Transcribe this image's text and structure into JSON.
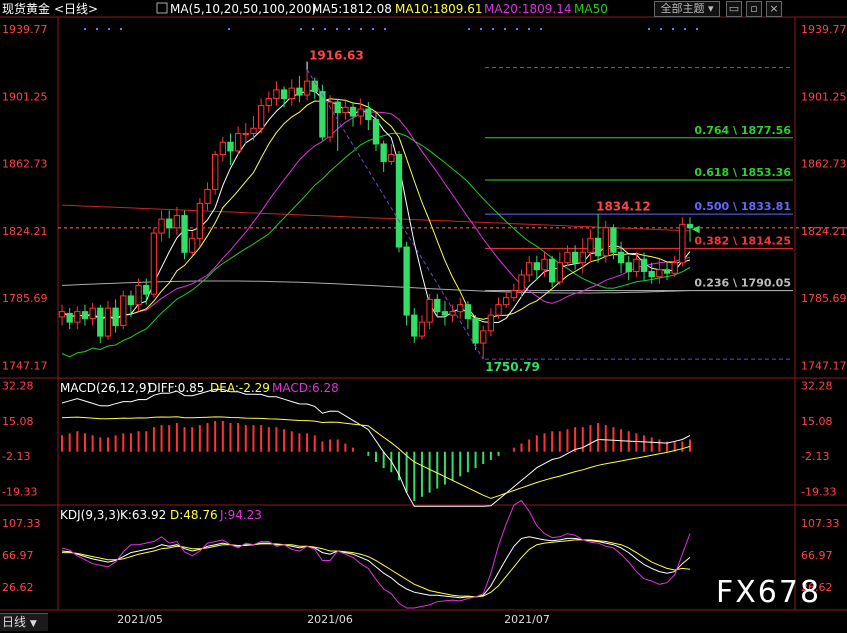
{
  "header": {
    "instrument": "现货黄金",
    "period": "日线",
    "ma_label": "MA(5,10,20,50,100,200)",
    "ma5": "MA5:1812.08",
    "ma10": "MA10:1809.61",
    "ma20": "MA20:1809.14",
    "ma50": "MA50",
    "theme_button": "全部主题",
    "colors": {
      "ma5": "#ffffff",
      "ma10": "#ffff44",
      "ma20": "#dd33dd",
      "ma50": "#22cc22",
      "ma100": "#aaaaaa",
      "ma200": "#cc2222"
    }
  },
  "price_axis": {
    "labels": [
      "1939.77",
      "1901.25",
      "1862.73",
      "1824.21",
      "1785.69",
      "1747.17"
    ],
    "values": [
      1939.77,
      1901.25,
      1862.73,
      1824.21,
      1785.69,
      1747.17
    ]
  },
  "annotations": {
    "high": "1916.63",
    "low": "1750.79",
    "recent_high": "1834.12"
  },
  "fibonacci": [
    {
      "label": "0.764 \\ 1877.56",
      "value": 1877.56,
      "color": "#33cc33"
    },
    {
      "label": "0.618 \\ 1853.36",
      "value": 1853.36,
      "color": "#33cc33"
    },
    {
      "label": "0.500 \\ 1833.81",
      "value": 1833.81,
      "color": "#6666ff"
    },
    {
      "label": "0.382 \\ 1814.25",
      "value": 1814.25,
      "color": "#ff3333"
    },
    {
      "label": "0.236 \\ 1790.05",
      "value": 1790.05,
      "color": "#bbbbbb"
    }
  ],
  "macd": {
    "title": "MACD(26,12,9)",
    "diff": "DIFF:0.85",
    "dea": "DEA:-2.29",
    "macd": "MACD:6.28",
    "axis_labels": [
      "32.28",
      "15.08",
      "-2.13",
      "-19.33"
    ],
    "axis_values": [
      32.28,
      15.08,
      -2.13,
      -19.33
    ]
  },
  "kdj": {
    "title": "KDJ(9,3,3)",
    "k": "K:63.92",
    "d": "D:48.76",
    "j": "J:94.23",
    "axis_labels": [
      "107.33",
      "66.97",
      "26.62"
    ],
    "axis_values": [
      107.33,
      66.97,
      26.62
    ]
  },
  "time_axis": [
    "2021/05",
    "2021/06",
    "2021/07"
  ],
  "bottom_tab": "日线",
  "watermark": "FX678",
  "chart_data": [
    {
      "type": "candlestick",
      "title": "现货黄金",
      "period": "日线",
      "ylim": [
        1740,
        1945
      ],
      "candles": [
        [
          1775,
          1778,
          1770,
          1782
        ],
        [
          1777,
          1772,
          1768,
          1780
        ],
        [
          1772,
          1778,
          1768,
          1781
        ],
        [
          1778,
          1774,
          1770,
          1782
        ],
        [
          1774,
          1780,
          1770,
          1783
        ],
        [
          1780,
          1764,
          1760,
          1782
        ],
        [
          1764,
          1780,
          1762,
          1784
        ],
        [
          1780,
          1770,
          1766,
          1785
        ],
        [
          1770,
          1787,
          1768,
          1790
        ],
        [
          1787,
          1782,
          1775,
          1790
        ],
        [
          1782,
          1793,
          1778,
          1797
        ],
        [
          1793,
          1788,
          1782,
          1797
        ],
        [
          1788,
          1823,
          1786,
          1826
        ],
        [
          1823,
          1831,
          1818,
          1836
        ],
        [
          1831,
          1826,
          1820,
          1836
        ],
        [
          1826,
          1833,
          1822,
          1838
        ],
        [
          1833,
          1812,
          1808,
          1836
        ],
        [
          1812,
          1820,
          1810,
          1824
        ],
        [
          1820,
          1840,
          1815,
          1843
        ],
        [
          1840,
          1848,
          1836,
          1852
        ],
        [
          1848,
          1868,
          1845,
          1870
        ],
        [
          1868,
          1875,
          1864,
          1878
        ],
        [
          1875,
          1870,
          1862,
          1880
        ],
        [
          1870,
          1880,
          1868,
          1884
        ],
        [
          1880,
          1880,
          1874,
          1886
        ],
        [
          1880,
          1883,
          1876,
          1890
        ],
        [
          1883,
          1896,
          1880,
          1900
        ],
        [
          1896,
          1900,
          1892,
          1904
        ],
        [
          1900,
          1905,
          1896,
          1910
        ],
        [
          1905,
          1900,
          1895,
          1907
        ],
        [
          1900,
          1906,
          1896,
          1911
        ],
        [
          1906,
          1902,
          1898,
          1913
        ],
        [
          1902,
          1910,
          1899,
          1916.63
        ],
        [
          1910,
          1904,
          1900,
          1912
        ],
        [
          1904,
          1878,
          1876,
          1908
        ],
        [
          1878,
          1898,
          1875,
          1902
        ],
        [
          1898,
          1892,
          1870,
          1900
        ],
        [
          1892,
          1895,
          1888,
          1899
        ],
        [
          1895,
          1890,
          1884,
          1898
        ],
        [
          1890,
          1894,
          1885,
          1900
        ],
        [
          1894,
          1888,
          1882,
          1898
        ],
        [
          1888,
          1874,
          1870,
          1892
        ],
        [
          1874,
          1864,
          1858,
          1876
        ],
        [
          1864,
          1868,
          1862,
          1874
        ],
        [
          1868,
          1815,
          1812,
          1870
        ],
        [
          1815,
          1776,
          1770,
          1818
        ],
        [
          1776,
          1764,
          1760,
          1780
        ],
        [
          1764,
          1772,
          1762,
          1776
        ],
        [
          1772,
          1785,
          1768,
          1788
        ],
        [
          1785,
          1778,
          1775,
          1788
        ],
        [
          1778,
          1776,
          1770,
          1784
        ],
        [
          1776,
          1778,
          1772,
          1782
        ],
        [
          1778,
          1782,
          1774,
          1786
        ],
        [
          1782,
          1774,
          1768,
          1784
        ],
        [
          1774,
          1760,
          1756,
          1776
        ],
        [
          1760,
          1767,
          1750.79,
          1770
        ],
        [
          1767,
          1776,
          1764,
          1780
        ],
        [
          1776,
          1782,
          1774,
          1786
        ],
        [
          1782,
          1786,
          1780,
          1790
        ],
        [
          1786,
          1790,
          1784,
          1794
        ],
        [
          1790,
          1799,
          1786,
          1802
        ],
        [
          1799,
          1806,
          1795,
          1810
        ],
        [
          1806,
          1802,
          1796,
          1810
        ],
        [
          1802,
          1808,
          1798,
          1812
        ],
        [
          1808,
          1795,
          1792,
          1810
        ],
        [
          1795,
          1806,
          1793,
          1812
        ],
        [
          1806,
          1812,
          1804,
          1816
        ],
        [
          1812,
          1806,
          1802,
          1816
        ],
        [
          1806,
          1812,
          1800,
          1820
        ],
        [
          1812,
          1820,
          1806,
          1825
        ],
        [
          1820,
          1810,
          1806,
          1834.12
        ],
        [
          1810,
          1826,
          1806,
          1830
        ],
        [
          1826,
          1812,
          1808,
          1828
        ],
        [
          1812,
          1806,
          1800,
          1818
        ],
        [
          1806,
          1801,
          1796,
          1810
        ],
        [
          1801,
          1808,
          1798,
          1812
        ],
        [
          1808,
          1801,
          1796,
          1812
        ],
        [
          1801,
          1798,
          1794,
          1806
        ],
        [
          1798,
          1802,
          1794,
          1808
        ],
        [
          1802,
          1800,
          1796,
          1806
        ],
        [
          1800,
          1806,
          1798,
          1810
        ],
        [
          1806,
          1828,
          1804,
          1832
        ],
        [
          1828,
          1826,
          1818,
          1832
        ]
      ]
    },
    {
      "type": "bar",
      "title": "MACD(26,12,9)",
      "ylim": [
        -26,
        36
      ],
      "series": [
        {
          "name": "MACD",
          "values": [
            8,
            9,
            10,
            9,
            8,
            7,
            7,
            8,
            9,
            9,
            10,
            10,
            12,
            13,
            13,
            14,
            12,
            12,
            13,
            14,
            15,
            15,
            14,
            14,
            13,
            13,
            13,
            12,
            12,
            11,
            10,
            9,
            9,
            8,
            5,
            6,
            6,
            4,
            2,
            0,
            -2,
            -5,
            -8,
            -10,
            -14,
            -20,
            -24,
            -22,
            -20,
            -18,
            -16,
            -14,
            -12,
            -10,
            -8,
            -6,
            -4,
            -2,
            0,
            2,
            4,
            6,
            8,
            9,
            10,
            10,
            11,
            12,
            12,
            13,
            14,
            13,
            12,
            11,
            10,
            9,
            8,
            7,
            6,
            5,
            5,
            5,
            6
          ]
        }
      ]
    },
    {
      "type": "line",
      "title": "KDJ(9,3,3)",
      "ylim": [
        0,
        115
      ],
      "series": [
        {
          "name": "K",
          "values": [
            72,
            71,
            68,
            65,
            62,
            60,
            58,
            60,
            65,
            70,
            72,
            74,
            76,
            80,
            78,
            80,
            75,
            72,
            74,
            78,
            80,
            82,
            80,
            78,
            80,
            80,
            82,
            82,
            80,
            80,
            78,
            76,
            78,
            76,
            70,
            68,
            72,
            70,
            68,
            64,
            60,
            52,
            44,
            38,
            30,
            24,
            20,
            18,
            16,
            16,
            15,
            14,
            13,
            14,
            14,
            16,
            28,
            45,
            62,
            78,
            88,
            90,
            88,
            86,
            85,
            86,
            88,
            88,
            86,
            85,
            84,
            82,
            80,
            76,
            70,
            62,
            55,
            50,
            46,
            44,
            46,
            56,
            64
          ]
        },
        {
          "name": "D",
          "values": [
            70,
            70,
            69,
            67,
            65,
            63,
            61,
            61,
            62,
            65,
            68,
            70,
            72,
            75,
            76,
            78,
            77,
            75,
            75,
            76,
            78,
            80,
            80,
            79,
            79,
            80,
            81,
            81,
            81,
            80,
            80,
            78,
            78,
            77,
            75,
            72,
            72,
            71,
            70,
            68,
            65,
            60,
            54,
            48,
            42,
            36,
            30,
            26,
            22,
            20,
            18,
            16,
            15,
            15,
            14,
            15,
            20,
            28,
            40,
            52,
            64,
            74,
            80,
            82,
            83,
            84,
            85,
            86,
            86,
            86,
            85,
            84,
            82,
            80,
            76,
            70,
            64,
            58,
            54,
            50,
            48,
            50,
            49
          ]
        },
        {
          "name": "J",
          "values": [
            76,
            73,
            66,
            61,
            56,
            54,
            52,
            58,
            71,
            80,
            80,
            82,
            84,
            90,
            82,
            84,
            71,
            66,
            72,
            82,
            84,
            86,
            80,
            76,
            82,
            80,
            84,
            84,
            78,
            80,
            74,
            72,
            78,
            74,
            60,
            60,
            72,
            68,
            64,
            56,
            50,
            36,
            24,
            18,
            6,
            0,
            0,
            2,
            4,
            8,
            9,
            10,
            9,
            12,
            14,
            18,
            44,
            79,
            106,
            130,
            136,
            122,
            104,
            94,
            89,
            90,
            94,
            92,
            86,
            83,
            82,
            78,
            76,
            68,
            58,
            46,
            37,
            34,
            30,
            32,
            42,
            68,
            94
          ]
        }
      ]
    }
  ]
}
